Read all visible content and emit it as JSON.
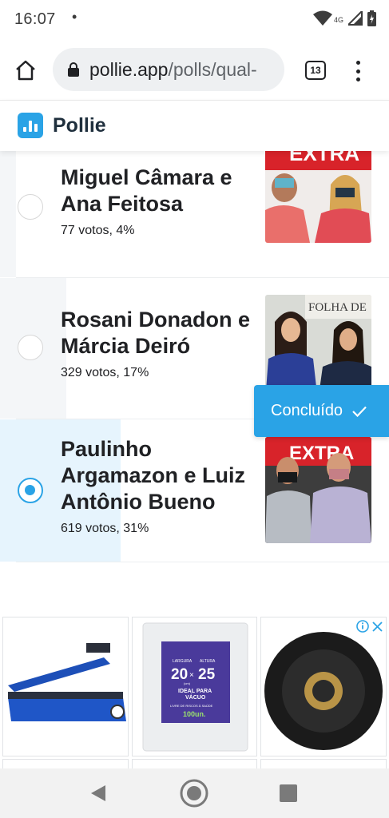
{
  "status_bar": {
    "time": "16:07",
    "dot": "•",
    "network": "4G",
    "icons": [
      "wifi-icon",
      "signal-icon",
      "battery-icon"
    ]
  },
  "browser": {
    "url_host": "pollie.app",
    "url_path": "/polls/qual-",
    "tab_count": "13",
    "icons": [
      "home-icon",
      "lock-icon",
      "tabs-icon",
      "more-vert-icon"
    ]
  },
  "app": {
    "name": "Pollie",
    "logo_icon": "bar-chart-icon",
    "accent_color": "#2aa3e6"
  },
  "poll": {
    "options": [
      {
        "name": "Miguel Câmara e Ana Feitosa",
        "meta": "77 votos, 4%",
        "percent": 4,
        "selected": false,
        "photo_label": "EXTRA"
      },
      {
        "name": "Rosani Donadon e Márcia Deiró",
        "meta": "329 votos, 17%",
        "percent": 17,
        "selected": false,
        "photo_label": "FOLHA DE"
      },
      {
        "name": "Paulinho Argamazon e Luiz Antônio Bueno",
        "meta": "619 votos, 31%",
        "percent": 31,
        "selected": true,
        "photo_label": "EXTRA"
      }
    ]
  },
  "toast": {
    "label": "Concluído",
    "icon": "check-icon"
  },
  "ads": {
    "icons": [
      "adchoices-info-icon",
      "close-icon"
    ],
    "items": [
      {
        "icon": "heat-sealer-image"
      },
      {
        "icon": "vacuum-bag-image",
        "largura_label": "LARGURA",
        "altura_label": "ALTURA",
        "width": "20",
        "times": "×",
        "height": "25",
        "unit": "(cm)",
        "ideal": "IDEAL PARA",
        "vacuo": "VÁCUO",
        "bpa": "LIVRE DE RISCOS À SAÚDE",
        "count": "100un."
      },
      {
        "icon": "knob-image"
      }
    ]
  },
  "nav": {
    "icons": [
      "back-icon",
      "home-circle-icon",
      "recents-icon"
    ]
  }
}
